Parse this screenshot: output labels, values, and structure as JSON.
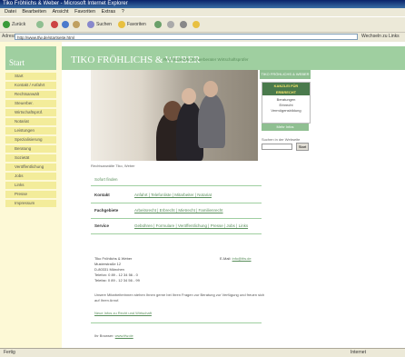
{
  "window": {
    "title": "Tiko Fröhlichs & Weber - Microsoft Internet Explorer"
  },
  "menu": [
    "Datei",
    "Bearbeiten",
    "Ansicht",
    "Favoriten",
    "Extras",
    "?"
  ],
  "toolbar": {
    "back": "Zurück",
    "search": "Suchen",
    "favorites": "Favoriten"
  },
  "address": {
    "label": "Adresse",
    "url": "http://www.tfw.de/startseite.html",
    "go": "Wechseln zu",
    "links": "Links"
  },
  "sidebar": {
    "start": "Start",
    "items": [
      "Start",
      "Kontakt / Anfahrt",
      "Rechtsanwält",
      "Steuerber.",
      "Wirtschaftsprüf.",
      "Notariat",
      "Leistungen",
      "Spezialisierung",
      "Beratung",
      "Sozietät",
      "Veröffentlichung",
      "Jobs",
      "Links",
      "Presse",
      "Impressum"
    ]
  },
  "header": {
    "firm": "TIKO FRÖHLICHS & WEBER",
    "tagline": "Rechtsanwälte Steuerberater Wirtschaftsprüfer"
  },
  "photo_caption": "Rechtsanwälte Tiko, Weber",
  "rightbox": {
    "title": "TIKO FRÖHLICHS & WEBER",
    "ad_lines": [
      "KANZLEI FÜR",
      "ERBRECHT",
      "Beratung",
      "Prozess",
      "Verfügungen"
    ],
    "ad_sub": [
      "Beratungen",
      "Erbrecht",
      "Vermögensbildung"
    ],
    "button": "Mehr Infos",
    "search_label": "Suchen in der Webseite",
    "search_go": "Start"
  },
  "section_title": "Sofort finden",
  "rows": [
    {
      "label": "Kontakt",
      "links": "Anfahrt | Telefonliste | Mitarbeiter | Notariat"
    },
    {
      "label": "Fachgebiete",
      "links": "Arbeitsrecht | Erbrecht | Mietrecht | Familienrecht"
    },
    {
      "label": "Service",
      "links": "Gebühren | Formulare | Veröffentlichung | Presse | Jobs | Links"
    }
  ],
  "address_block": [
    "Tiko Fröhlichs & Weber",
    "Musterstraße 12",
    "D-80331 München",
    "Telefon: 0 89 - 12 34 56 - 0",
    "Telefax: 0 89 - 12 34 56 - 99"
  ],
  "email": {
    "label": "E-Mail:",
    "value": "info@tfw.de"
  },
  "note": "Unsere Mitarbeiterinnen stehen Ihnen gerne bei Ihren Fragen zur Beratung zur Verfügung und freuen sich auf Ihren Anruf.",
  "links": [
    "Neue Infos zu Recht und Wirtschaft",
    "Besuchen Sie unsere Seite"
  ],
  "footer": {
    "label": "Ihr Browser:",
    "value": "www.tfw.de"
  },
  "status": {
    "left": "Fertig",
    "zone": "Internet"
  }
}
